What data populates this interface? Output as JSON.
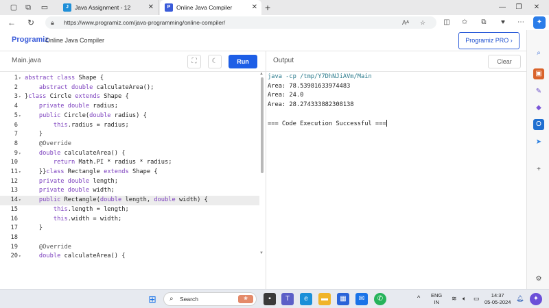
{
  "browser": {
    "tabs": [
      {
        "title": "Java Assignment - 12",
        "favicon": "J",
        "active": false
      },
      {
        "title": "Online Java Compiler",
        "favicon": "P",
        "active": true
      }
    ],
    "url": "https://www.programiz.com/java-programming/online-compiler/"
  },
  "site": {
    "logo": "Programiz",
    "title": "Online Java Compiler",
    "pro_button": "Programiz PRO ›"
  },
  "editor": {
    "file_name": "Main.java",
    "run_label": "Run",
    "active_line": 14,
    "lines": [
      {
        "n": "1",
        "fold": true,
        "code": "abstract class Shape {"
      },
      {
        "n": "2",
        "fold": false,
        "code": "    abstract double calculateArea();"
      },
      {
        "n": "3",
        "fold": true,
        "code": "}class Circle extends Shape {"
      },
      {
        "n": "4",
        "fold": false,
        "code": "    private double radius;"
      },
      {
        "n": "5",
        "fold": true,
        "code": "    public Circle(double radius) {"
      },
      {
        "n": "6",
        "fold": false,
        "code": "        this.radius = radius;"
      },
      {
        "n": "7",
        "fold": false,
        "code": "    }"
      },
      {
        "n": "8",
        "fold": false,
        "code": "    @Override"
      },
      {
        "n": "9",
        "fold": true,
        "code": "    double calculateArea() {"
      },
      {
        "n": "10",
        "fold": false,
        "code": "        return Math.PI * radius * radius;"
      },
      {
        "n": "11",
        "fold": true,
        "code": "    }}class Rectangle extends Shape {"
      },
      {
        "n": "12",
        "fold": false,
        "code": "    private double length;"
      },
      {
        "n": "13",
        "fold": false,
        "code": "    private double width;"
      },
      {
        "n": "14",
        "fold": true,
        "code": "    public Rectangle(double length, double width) {"
      },
      {
        "n": "15",
        "fold": false,
        "code": "        this.length = length;"
      },
      {
        "n": "16",
        "fold": false,
        "code": "        this.width = width;"
      },
      {
        "n": "17",
        "fold": false,
        "code": "    }"
      },
      {
        "n": "18",
        "fold": false,
        "code": ""
      },
      {
        "n": "19",
        "fold": false,
        "code": "    @Override"
      },
      {
        "n": "20",
        "fold": true,
        "code": "    double calculateArea() {"
      }
    ]
  },
  "output": {
    "title": "Output",
    "clear_label": "Clear",
    "lines": [
      {
        "text": "java -cp /tmp/Y7DhNJiAVm/Main",
        "type": "cmd"
      },
      {
        "text": "Area: 78.53981633974483",
        "type": "out"
      },
      {
        "text": "Area: 24.0",
        "type": "out"
      },
      {
        "text": "Area: 28.274333882308138",
        "type": "out"
      },
      {
        "text": "",
        "type": "out"
      },
      {
        "text": "=== Code Execution Successful ===",
        "type": "out"
      }
    ]
  },
  "taskbar": {
    "search_label": "Search",
    "language": "ENG",
    "region": "IN",
    "time": "14:37",
    "date": "05-05-2024"
  },
  "colors": {
    "run_button": "#1d5ee6",
    "keyword": "#7a3dbd",
    "command_output": "#2a7a8c"
  }
}
